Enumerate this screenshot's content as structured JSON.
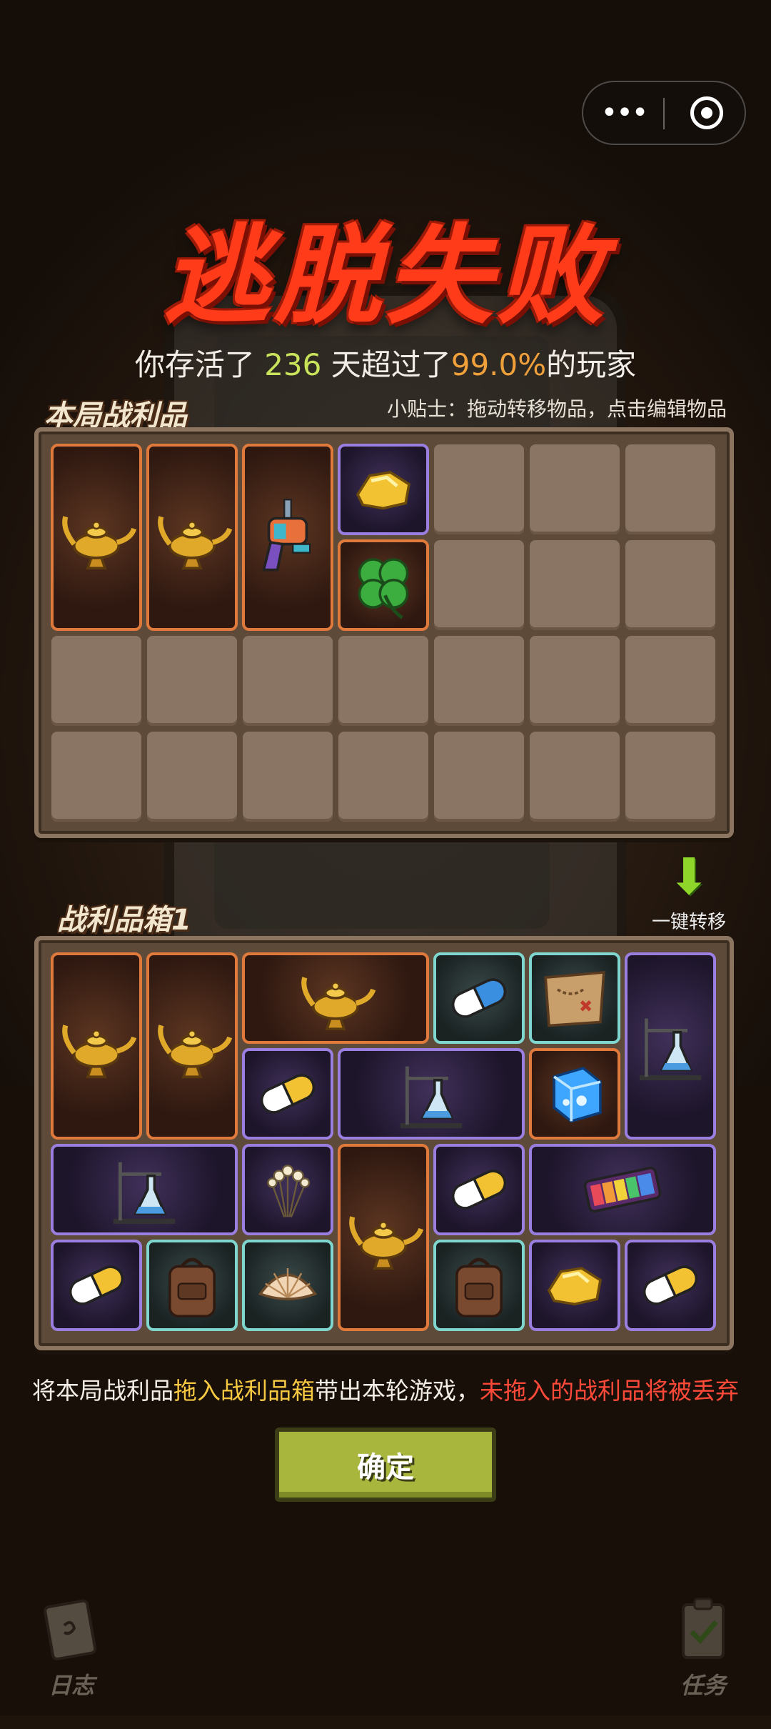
{
  "capsule": {
    "more_icon": "more-dots-icon",
    "close_icon": "target-circle-icon"
  },
  "title": "逃脱失败",
  "survive": {
    "prefix": "你存活了 ",
    "days": "236",
    "middle": " 天超过了",
    "percent": "99.0%",
    "suffix": "的玩家"
  },
  "loot_section": {
    "label": "本局战利品"
  },
  "tip": "小贴士：拖动转移物品，点击编辑物品",
  "loot_items": [
    {
      "name": "magic-lamp",
      "rarity": "orange"
    },
    {
      "name": "magic-lamp",
      "rarity": "orange"
    },
    {
      "name": "toy-ray-gun",
      "rarity": "orange"
    },
    {
      "name": "gold-nugget",
      "rarity": "purple"
    },
    {
      "name": "four-leaf-clover",
      "rarity": "orange"
    }
  ],
  "transfer": {
    "icon": "down-arrow-icon",
    "label": "一键转移"
  },
  "box_section": {
    "label": "战利品箱1"
  },
  "box_items": [
    {
      "name": "magic-lamp",
      "rarity": "orange"
    },
    {
      "name": "magic-lamp",
      "rarity": "orange"
    },
    {
      "name": "magic-lamp",
      "rarity": "orange"
    },
    {
      "name": "blue-pill",
      "rarity": "teal"
    },
    {
      "name": "treasure-map",
      "rarity": "teal"
    },
    {
      "name": "lab-flask-stand",
      "rarity": "purple"
    },
    {
      "name": "yellow-pill",
      "rarity": "purple"
    },
    {
      "name": "lab-flask-stand",
      "rarity": "purple"
    },
    {
      "name": "ice-cube",
      "rarity": "orange"
    },
    {
      "name": "lab-flask-stand",
      "rarity": "purple"
    },
    {
      "name": "enoki-mushroom",
      "rarity": "purple"
    },
    {
      "name": "magic-lamp",
      "rarity": "orange"
    },
    {
      "name": "yellow-pill",
      "rarity": "purple"
    },
    {
      "name": "rainbow-keyboard",
      "rarity": "purple"
    },
    {
      "name": "yellow-pill",
      "rarity": "purple"
    },
    {
      "name": "leather-backpack",
      "rarity": "teal"
    },
    {
      "name": "seashell",
      "rarity": "teal"
    },
    {
      "name": "leather-backpack",
      "rarity": "teal"
    },
    {
      "name": "gold-nugget",
      "rarity": "purple"
    },
    {
      "name": "yellow-pill",
      "rarity": "purple"
    }
  ],
  "instruction": {
    "part1": "将本局战利品",
    "part2": "拖入战利品箱",
    "part3": "带出本轮游戏，",
    "part4": "未拖入的战利品将被丢弃"
  },
  "confirm_label": "确定",
  "bottom": {
    "log_label": "日志",
    "task_label": "任务"
  },
  "colors": {
    "title": "#ff3b1a",
    "days": "#c9e35a",
    "percent": "#f0a03a",
    "highlight": "#f7c842",
    "warning": "#ff4a3a",
    "confirm": "#a8b63d",
    "rarity_orange": "#e07a3c",
    "rarity_purple": "#9a7ee0",
    "rarity_teal": "#7fd6cf"
  }
}
